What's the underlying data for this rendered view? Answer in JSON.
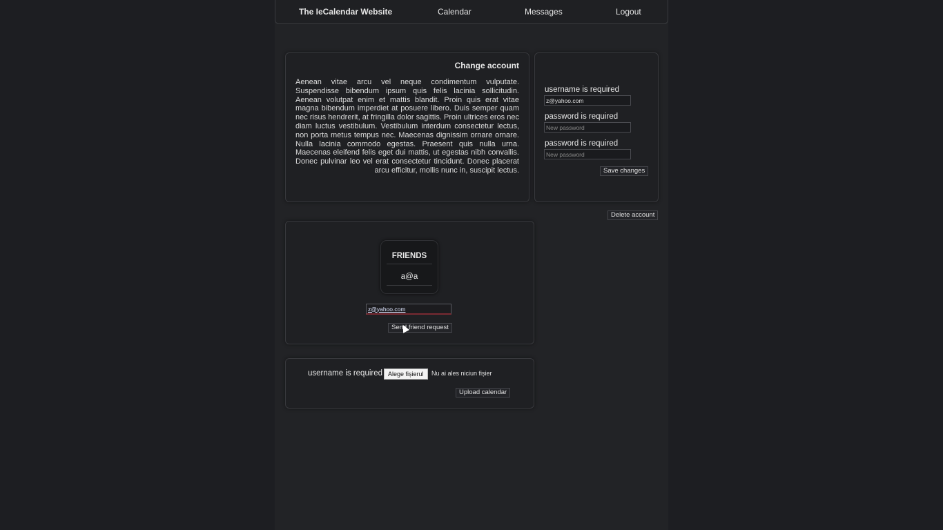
{
  "navbar": {
    "brand": "The IeCalendar Website",
    "calendar": "Calendar",
    "messages": "Messages",
    "logout": "Logout"
  },
  "about": {
    "title": "Change account",
    "text": "Aenean vitae arcu vel neque condimentum vulputate. Suspendisse bibendum ipsum quis felis lacinia sollicitudin. Aenean volutpat enim et mattis blandit. Proin quis erat vitae magna bibendum imperdiet at posuere libero. Duis semper quam nec risus hendrerit, at fringilla dolor sagittis. Proin ultrices eros nec diam luctus vestibulum. Vestibulum interdum consectetur lectus, non porta metus tempus nec. Maecenas dignissim ornare ornare. Nulla lacinia commodo egestas. Praesent quis nulla urna. Maecenas eleifend felis eget dui mattis, ut egestas nibh convallis. Donec pulvinar leo vel erat consectetur tincidunt. Donec placerat arcu efficitur, mollis nunc in, suscipit lectus."
  },
  "account_form": {
    "username_label": "username is required",
    "username_value": "z@yahoo.com",
    "password_label": "password is required",
    "password_placeholder": "New password",
    "confirm_label": "password is required",
    "confirm_placeholder": "New password",
    "save_button": "Save changes",
    "delete_button": "Delete account"
  },
  "friends": {
    "title": "FRIENDS",
    "entries": [
      "a@a"
    ],
    "request_input_value": "z@yahoo.com",
    "request_button": "Send friend request"
  },
  "upload": {
    "label": "username is required",
    "choose_file_button": "Alege fișierul",
    "file_status": "Nu ai ales niciun fișier",
    "upload_button": "Upload calendar"
  }
}
